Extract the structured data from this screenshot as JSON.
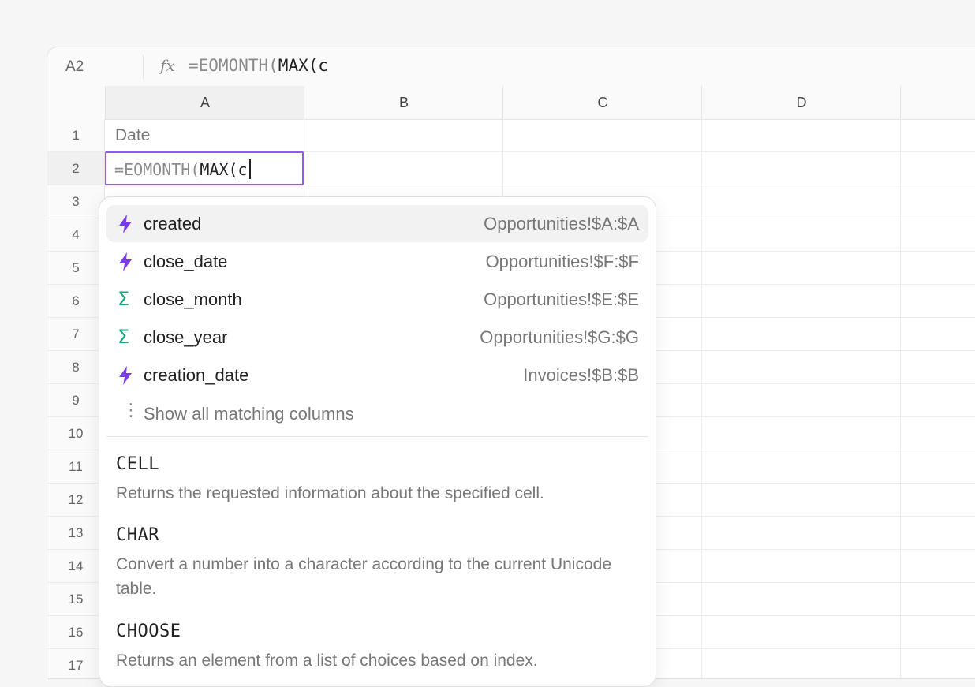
{
  "formula_bar": {
    "cell_ref": "A2",
    "fx": "fx",
    "formula_muted": "=EOMONTH(",
    "formula_strong": "MAX(c"
  },
  "columns": [
    "A",
    "B",
    "C",
    "D"
  ],
  "rows": [
    "1",
    "2",
    "3",
    "4",
    "5",
    "6",
    "7",
    "8",
    "9",
    "10",
    "11",
    "12",
    "13",
    "14",
    "15",
    "16",
    "17"
  ],
  "cells": {
    "A1": "Date",
    "A2_muted": "=EOMONTH(",
    "A2_strong": "MAX(c"
  },
  "autocomplete": {
    "columns": [
      {
        "icon": "bolt-icon",
        "name": "created",
        "ref": "Opportunities!$A:$A",
        "selected": true
      },
      {
        "icon": "bolt-icon",
        "name": "close_date",
        "ref": "Opportunities!$F:$F"
      },
      {
        "icon": "sigma-icon",
        "name": "close_month",
        "ref": "Opportunities!$E:$E"
      },
      {
        "icon": "sigma-icon",
        "name": "close_year",
        "ref": "Opportunities!$G:$G"
      },
      {
        "icon": "bolt-icon",
        "name": "creation_date",
        "ref": "Invoices!$B:$B"
      }
    ],
    "show_all_label": "Show all matching columns",
    "functions": [
      {
        "name": "CELL",
        "desc": "Returns the requested information about the specified cell."
      },
      {
        "name": "CHAR",
        "desc": "Convert a number into a character according to the current Unicode table."
      },
      {
        "name": "CHOOSE",
        "desc": "Returns an element from a list of choices based on index."
      }
    ]
  },
  "colors": {
    "accent": "#8c5cf5",
    "bolt": "#7c3aed",
    "sigma": "#1aa37a"
  }
}
